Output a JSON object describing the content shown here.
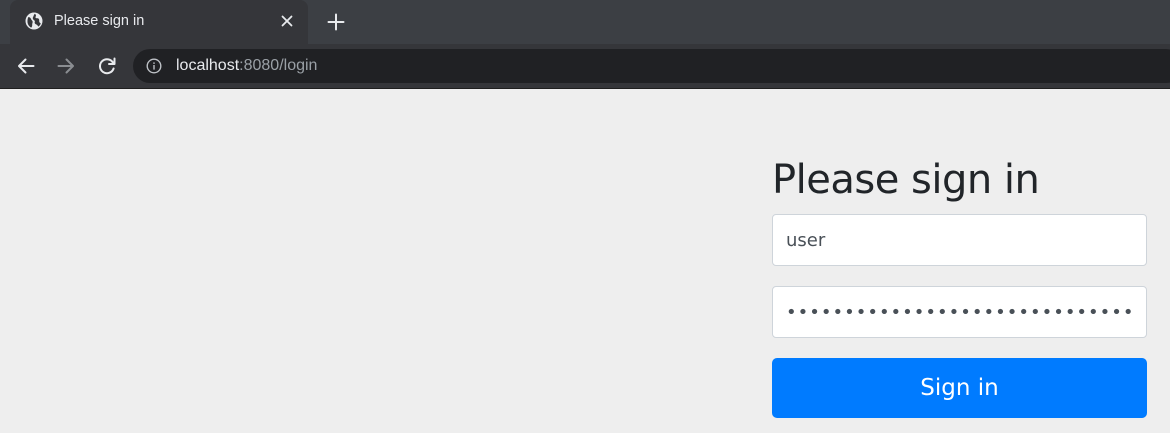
{
  "browser": {
    "tab": {
      "title": "Please sign in",
      "favicon": "globe-icon",
      "close": "close-icon"
    },
    "new_tab": "plus-icon",
    "nav": {
      "back": "arrow-left-icon",
      "forward": "arrow-right-icon",
      "reload": "reload-icon"
    },
    "address": {
      "security_icon": "info-icon",
      "host": "localhost",
      "rest": ":8080/login"
    }
  },
  "login_form": {
    "heading": "Please sign in",
    "username_value": "user",
    "password_value": "••••••••••••••••••••••••••••••••••••",
    "submit_label": "Sign in"
  },
  "colors": {
    "primary_button": "#007bff",
    "page_background": "#eeeeee",
    "tabbar_background": "#3c3f44",
    "toolbar_background": "#35363a",
    "omnibox_background": "#202124"
  }
}
